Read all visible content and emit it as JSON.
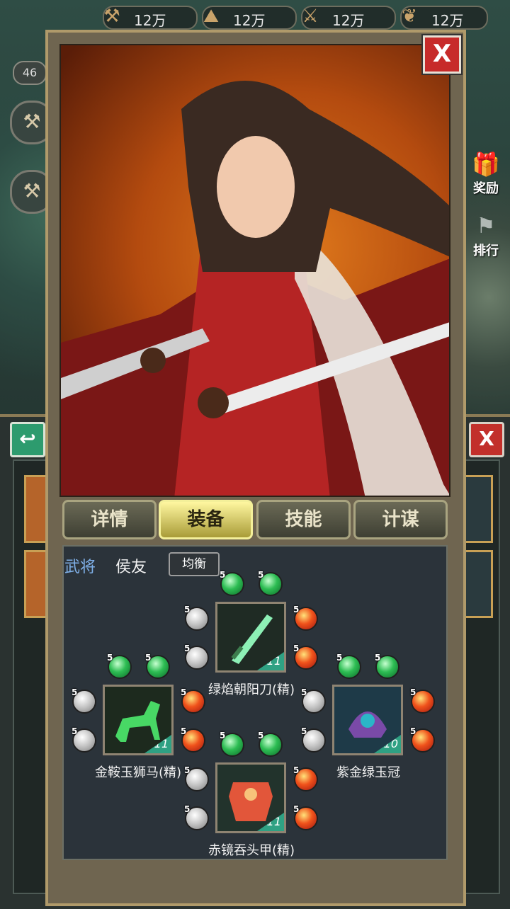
{
  "resources": [
    {
      "icon": "timber-icon",
      "value": "12万"
    },
    {
      "icon": "stone-icon",
      "value": "12万"
    },
    {
      "icon": "iron-icon",
      "value": "12万"
    },
    {
      "icon": "grain-icon",
      "value": "12万"
    }
  ],
  "player": {
    "level": "46"
  },
  "side": {
    "reward_label": "奖励",
    "rank_label": "排行"
  },
  "dialog": {
    "close_label": "X",
    "tabs": [
      {
        "label": "详情"
      },
      {
        "label": "装备"
      },
      {
        "label": "技能"
      },
      {
        "label": "计谋"
      }
    ],
    "active_tab": "装备",
    "general": {
      "label": "武将",
      "name": "侯友",
      "type": "均衡"
    },
    "equipment": {
      "weapon": {
        "name": "绿焰朝阳刀(精)",
        "level": "11",
        "icon": "sword-icon",
        "top_gems": [
          "5",
          "5"
        ],
        "left_gems": [
          "5",
          "5"
        ],
        "right_gems": [
          "5",
          "5"
        ]
      },
      "mount": {
        "name": "金鞍玉狮马(精)",
        "level": "11",
        "icon": "horse-icon",
        "top_gems": [
          "5",
          "5"
        ],
        "left_gems": [
          "5",
          "5"
        ],
        "right_gems": [
          "5",
          "5"
        ]
      },
      "helmet": {
        "name": "紫金绿玉冠",
        "level": "10",
        "icon": "helmet-icon",
        "top_gems": [
          "5",
          "5"
        ],
        "left_gems": [
          "5",
          "5"
        ],
        "right_gems": [
          "5",
          "5"
        ]
      },
      "armor": {
        "name": "赤镜吞头甲(精)",
        "level": "11",
        "icon": "armor-icon",
        "top_gems": [
          "5",
          "5"
        ],
        "left_gems": [
          "5",
          "5"
        ],
        "right_gems": [
          "5",
          "5"
        ]
      }
    }
  },
  "under": {
    "back_label": "↩",
    "close_label": "X"
  },
  "colors": {
    "gem_green": "#2dbd53",
    "gem_white": "#c8c8c8",
    "gem_red": "#f0521b",
    "active_tab": "#fff7a0",
    "level_badge": "#2fa183"
  }
}
